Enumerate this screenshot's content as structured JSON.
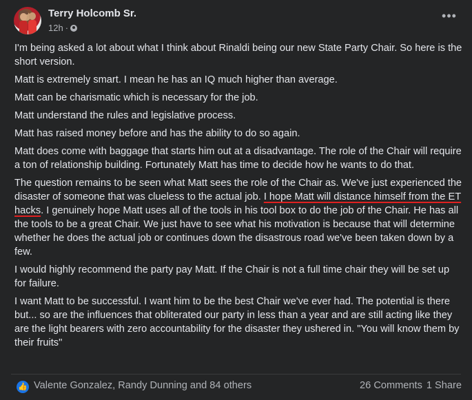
{
  "post": {
    "author": "Terry Holcomb Sr.",
    "time": "12h",
    "separator": "·",
    "audience_icon": "globe-icon",
    "more_icon": "more-options-icon",
    "more_glyph": "•••",
    "paragraphs": [
      "I'm being asked a lot about what I think about Rinaldi being our new State Party Chair. So here is the short version.",
      "Matt is extremely smart. I mean he has an IQ much higher than average.",
      "Matt can be charismatic which is necessary for the job.",
      "Matt understand the rules and legislative process.",
      "Matt has raised money before and has the ability to do so again.",
      "Matt does come with baggage that starts him out at a disadvantage. The role of the Chair will require a ton of relationship building. Fortunately Matt has time to decide how he wants to do that."
    ],
    "para7": {
      "before": "The question remains to be seen what Matt sees the role of the Chair as. We've just experienced the disaster of someone that was clueless to the actual job. ",
      "underlined": "I hope Matt will distance himself from the ET hacks",
      "after": ". I genuinely hope Matt uses all of the tools in his tool box to do the job of the Chair. He has all the tools to be a great Chair. We just have to see what his motivation is because that will determine whether he does the actual job or continues down the disastrous road we've been taken down by a few."
    },
    "paragraphs_end": [
      "I would highly recommend the party pay Matt. If the Chair is not a full time chair they will be set up for failure.",
      "I want Matt to be successful.  I want him to be the best Chair we've ever had. The potential is there but... so are the influences that obliterated our party in less than a year and are still acting like they are the light bearers with zero accountability for the disaster they ushered in. \"You will know them by their fruits\""
    ]
  },
  "footer": {
    "like_icon": "like-icon",
    "like_glyph": "👍",
    "reactors": "Valente Gonzalez, Randy Dunning and 84 others",
    "comments": "26 Comments",
    "shares": "1 Share"
  },
  "colors": {
    "background": "#242526",
    "text": "#e4e6eb",
    "secondary": "#b0b3b8",
    "like_blue": "#1b74e4",
    "annotation_red": "#e02020"
  }
}
